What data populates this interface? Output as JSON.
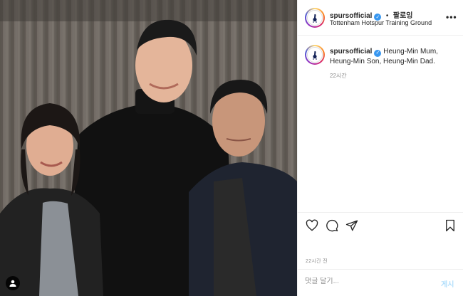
{
  "account": {
    "username": "spursofficial",
    "verified": true,
    "follow_label": "팔로잉",
    "separator": "•",
    "location": "Tottenham Hotspur Training Ground",
    "avatar_icon": "spurs-cockerel-icon"
  },
  "post": {
    "more_icon": "more-options-icon",
    "more_label": "•••",
    "caption": "Heung-Min Mum, Heung-Min Son, Heung-Min Dad.",
    "caption_time": "22시간",
    "post_time": "22시간 전",
    "tag_icon": "user-tag-icon"
  },
  "actions": {
    "like_icon": "heart-icon",
    "comment_icon": "comment-icon",
    "share_icon": "paper-plane-icon",
    "save_icon": "bookmark-icon"
  },
  "comment": {
    "placeholder": "댓글 달기...",
    "post_label": "게시"
  },
  "colors": {
    "verified_blue": "#3897f0",
    "post_button_disabled": "#b2dffc",
    "muted_text": "#8e8e8e"
  }
}
